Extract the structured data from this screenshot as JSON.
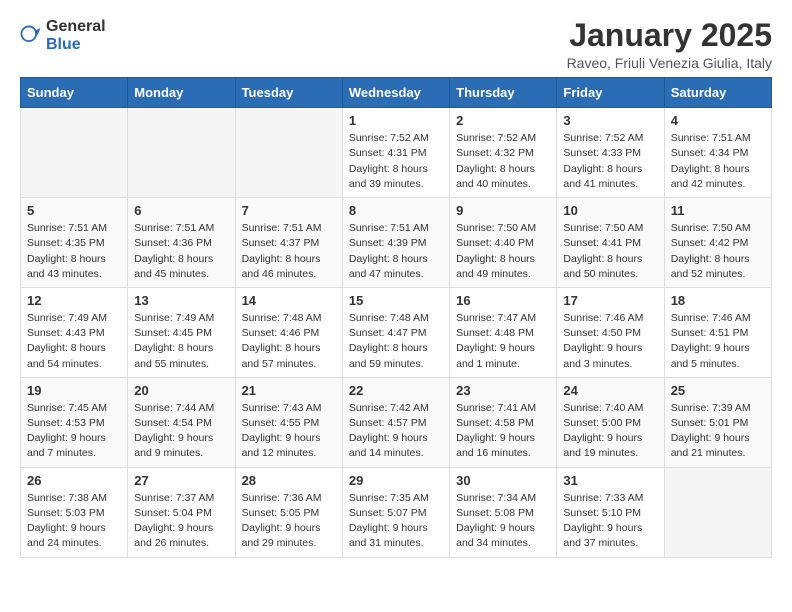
{
  "header": {
    "logo_general": "General",
    "logo_blue": "Blue",
    "month_title": "January 2025",
    "subtitle": "Raveo, Friuli Venezia Giulia, Italy"
  },
  "weekdays": [
    "Sunday",
    "Monday",
    "Tuesday",
    "Wednesday",
    "Thursday",
    "Friday",
    "Saturday"
  ],
  "weeks": [
    [
      {
        "day": "",
        "info": ""
      },
      {
        "day": "",
        "info": ""
      },
      {
        "day": "",
        "info": ""
      },
      {
        "day": "1",
        "info": "Sunrise: 7:52 AM\nSunset: 4:31 PM\nDaylight: 8 hours\nand 39 minutes."
      },
      {
        "day": "2",
        "info": "Sunrise: 7:52 AM\nSunset: 4:32 PM\nDaylight: 8 hours\nand 40 minutes."
      },
      {
        "day": "3",
        "info": "Sunrise: 7:52 AM\nSunset: 4:33 PM\nDaylight: 8 hours\nand 41 minutes."
      },
      {
        "day": "4",
        "info": "Sunrise: 7:51 AM\nSunset: 4:34 PM\nDaylight: 8 hours\nand 42 minutes."
      }
    ],
    [
      {
        "day": "5",
        "info": "Sunrise: 7:51 AM\nSunset: 4:35 PM\nDaylight: 8 hours\nand 43 minutes."
      },
      {
        "day": "6",
        "info": "Sunrise: 7:51 AM\nSunset: 4:36 PM\nDaylight: 8 hours\nand 45 minutes."
      },
      {
        "day": "7",
        "info": "Sunrise: 7:51 AM\nSunset: 4:37 PM\nDaylight: 8 hours\nand 46 minutes."
      },
      {
        "day": "8",
        "info": "Sunrise: 7:51 AM\nSunset: 4:39 PM\nDaylight: 8 hours\nand 47 minutes."
      },
      {
        "day": "9",
        "info": "Sunrise: 7:50 AM\nSunset: 4:40 PM\nDaylight: 8 hours\nand 49 minutes."
      },
      {
        "day": "10",
        "info": "Sunrise: 7:50 AM\nSunset: 4:41 PM\nDaylight: 8 hours\nand 50 minutes."
      },
      {
        "day": "11",
        "info": "Sunrise: 7:50 AM\nSunset: 4:42 PM\nDaylight: 8 hours\nand 52 minutes."
      }
    ],
    [
      {
        "day": "12",
        "info": "Sunrise: 7:49 AM\nSunset: 4:43 PM\nDaylight: 8 hours\nand 54 minutes."
      },
      {
        "day": "13",
        "info": "Sunrise: 7:49 AM\nSunset: 4:45 PM\nDaylight: 8 hours\nand 55 minutes."
      },
      {
        "day": "14",
        "info": "Sunrise: 7:48 AM\nSunset: 4:46 PM\nDaylight: 8 hours\nand 57 minutes."
      },
      {
        "day": "15",
        "info": "Sunrise: 7:48 AM\nSunset: 4:47 PM\nDaylight: 8 hours\nand 59 minutes."
      },
      {
        "day": "16",
        "info": "Sunrise: 7:47 AM\nSunset: 4:48 PM\nDaylight: 9 hours\nand 1 minute."
      },
      {
        "day": "17",
        "info": "Sunrise: 7:46 AM\nSunset: 4:50 PM\nDaylight: 9 hours\nand 3 minutes."
      },
      {
        "day": "18",
        "info": "Sunrise: 7:46 AM\nSunset: 4:51 PM\nDaylight: 9 hours\nand 5 minutes."
      }
    ],
    [
      {
        "day": "19",
        "info": "Sunrise: 7:45 AM\nSunset: 4:53 PM\nDaylight: 9 hours\nand 7 minutes."
      },
      {
        "day": "20",
        "info": "Sunrise: 7:44 AM\nSunset: 4:54 PM\nDaylight: 9 hours\nand 9 minutes."
      },
      {
        "day": "21",
        "info": "Sunrise: 7:43 AM\nSunset: 4:55 PM\nDaylight: 9 hours\nand 12 minutes."
      },
      {
        "day": "22",
        "info": "Sunrise: 7:42 AM\nSunset: 4:57 PM\nDaylight: 9 hours\nand 14 minutes."
      },
      {
        "day": "23",
        "info": "Sunrise: 7:41 AM\nSunset: 4:58 PM\nDaylight: 9 hours\nand 16 minutes."
      },
      {
        "day": "24",
        "info": "Sunrise: 7:40 AM\nSunset: 5:00 PM\nDaylight: 9 hours\nand 19 minutes."
      },
      {
        "day": "25",
        "info": "Sunrise: 7:39 AM\nSunset: 5:01 PM\nDaylight: 9 hours\nand 21 minutes."
      }
    ],
    [
      {
        "day": "26",
        "info": "Sunrise: 7:38 AM\nSunset: 5:03 PM\nDaylight: 9 hours\nand 24 minutes."
      },
      {
        "day": "27",
        "info": "Sunrise: 7:37 AM\nSunset: 5:04 PM\nDaylight: 9 hours\nand 26 minutes."
      },
      {
        "day": "28",
        "info": "Sunrise: 7:36 AM\nSunset: 5:05 PM\nDaylight: 9 hours\nand 29 minutes."
      },
      {
        "day": "29",
        "info": "Sunrise: 7:35 AM\nSunset: 5:07 PM\nDaylight: 9 hours\nand 31 minutes."
      },
      {
        "day": "30",
        "info": "Sunrise: 7:34 AM\nSunset: 5:08 PM\nDaylight: 9 hours\nand 34 minutes."
      },
      {
        "day": "31",
        "info": "Sunrise: 7:33 AM\nSunset: 5:10 PM\nDaylight: 9 hours\nand 37 minutes."
      },
      {
        "day": "",
        "info": ""
      }
    ]
  ]
}
